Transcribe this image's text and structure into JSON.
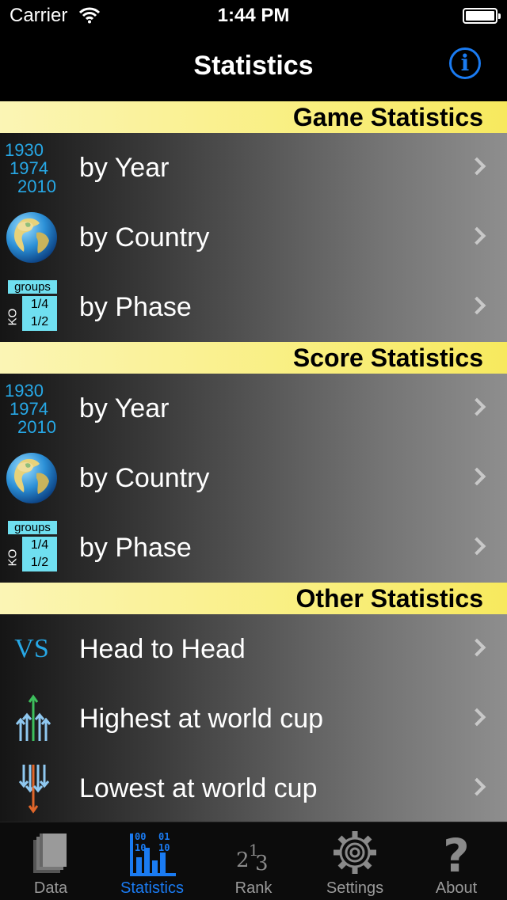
{
  "status_bar": {
    "carrier": "Carrier",
    "time": "1:44 PM"
  },
  "nav": {
    "title": "Statistics"
  },
  "sections": [
    {
      "header": "Game Statistics",
      "rows": [
        {
          "label": "by Year",
          "icon": "year-icon"
        },
        {
          "label": "by Country",
          "icon": "globe-icon"
        },
        {
          "label": "by Phase",
          "icon": "phase-icon"
        }
      ]
    },
    {
      "header": "Score Statistics",
      "rows": [
        {
          "label": "by Year",
          "icon": "year-icon"
        },
        {
          "label": "by Country",
          "icon": "globe-icon"
        },
        {
          "label": "by Phase",
          "icon": "phase-icon"
        }
      ]
    },
    {
      "header": "Other Statistics",
      "rows": [
        {
          "label": "Head to Head",
          "icon": "vs-icon"
        },
        {
          "label": "Highest at world cup",
          "icon": "arrows-up-icon"
        },
        {
          "label": "Lowest at world cup",
          "icon": "arrows-down-icon"
        }
      ]
    }
  ],
  "icon_text": {
    "years": [
      "1930",
      "1974",
      "2010"
    ],
    "groups": "groups",
    "quarter": "1/4",
    "half": "1/2",
    "ko": "KO",
    "vs": "VS",
    "binary": [
      "00",
      "01",
      "10",
      "10"
    ],
    "rank_glyphs": [
      "2",
      "1",
      "3"
    ],
    "question": "?"
  },
  "tabs": [
    {
      "label": "Data",
      "icon": "book-icon",
      "active": false
    },
    {
      "label": "Statistics",
      "icon": "bar-chart-icon",
      "active": true
    },
    {
      "label": "Rank",
      "icon": "rank-icon",
      "active": false
    },
    {
      "label": "Settings",
      "icon": "gear-icon",
      "active": false
    },
    {
      "label": "About",
      "icon": "question-icon",
      "active": false
    }
  ],
  "colors": {
    "accent": "#1a7bf2",
    "section_header": "#f9ef80",
    "icon_blue": "#27a8e6",
    "cyan_tile": "#6fdff0"
  }
}
